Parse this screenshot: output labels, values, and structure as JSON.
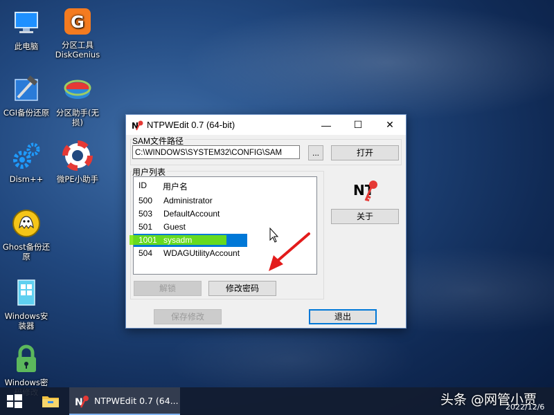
{
  "desktop": {
    "icons": [
      {
        "label": "此电脑"
      },
      {
        "label": "分区工具\nDiskGenius"
      },
      {
        "label": "CGI备份还原"
      },
      {
        "label": "分区助手(无\n损)"
      },
      {
        "label": "Dism++"
      },
      {
        "label": "微PE小助手"
      },
      {
        "label": "Ghost备份还\n原"
      },
      {
        "label": "Windows安\n装器"
      },
      {
        "label": "Windows密\n码修改"
      }
    ]
  },
  "window": {
    "title": "NTPWEdit 0.7 (64-bit)",
    "controls": {
      "minimize": "—",
      "maximize": "☐",
      "close": "✕"
    },
    "sam_label": "SAM文件路径",
    "sam_path": "C:\\WINDOWS\\SYSTEM32\\CONFIG\\SAM",
    "browse_label": "...",
    "open_label": "打开",
    "user_list_label": "用户列表",
    "columns": {
      "id": "ID",
      "name": "用户名"
    },
    "users": [
      {
        "id": "500",
        "name": "Administrator"
      },
      {
        "id": "503",
        "name": "DefaultAccount"
      },
      {
        "id": "501",
        "name": "Guest"
      },
      {
        "id": "1001",
        "name": "sysadm"
      },
      {
        "id": "504",
        "name": "WDAGUtilityAccount"
      }
    ],
    "unlock_label": "解锁",
    "change_pw_label": "修改密码",
    "about_label": "关于",
    "save_label": "保存修改",
    "exit_label": "退出",
    "logo_text": "NT"
  },
  "taskbar": {
    "task_title": "NTPWEdit 0.7 (64...",
    "watermark": "头条 @网管小贾",
    "date": "2022/12/6"
  },
  "colors": {
    "selection": "#0078d7",
    "highlight": "#78eb00",
    "arrow": "#e31b1b"
  }
}
